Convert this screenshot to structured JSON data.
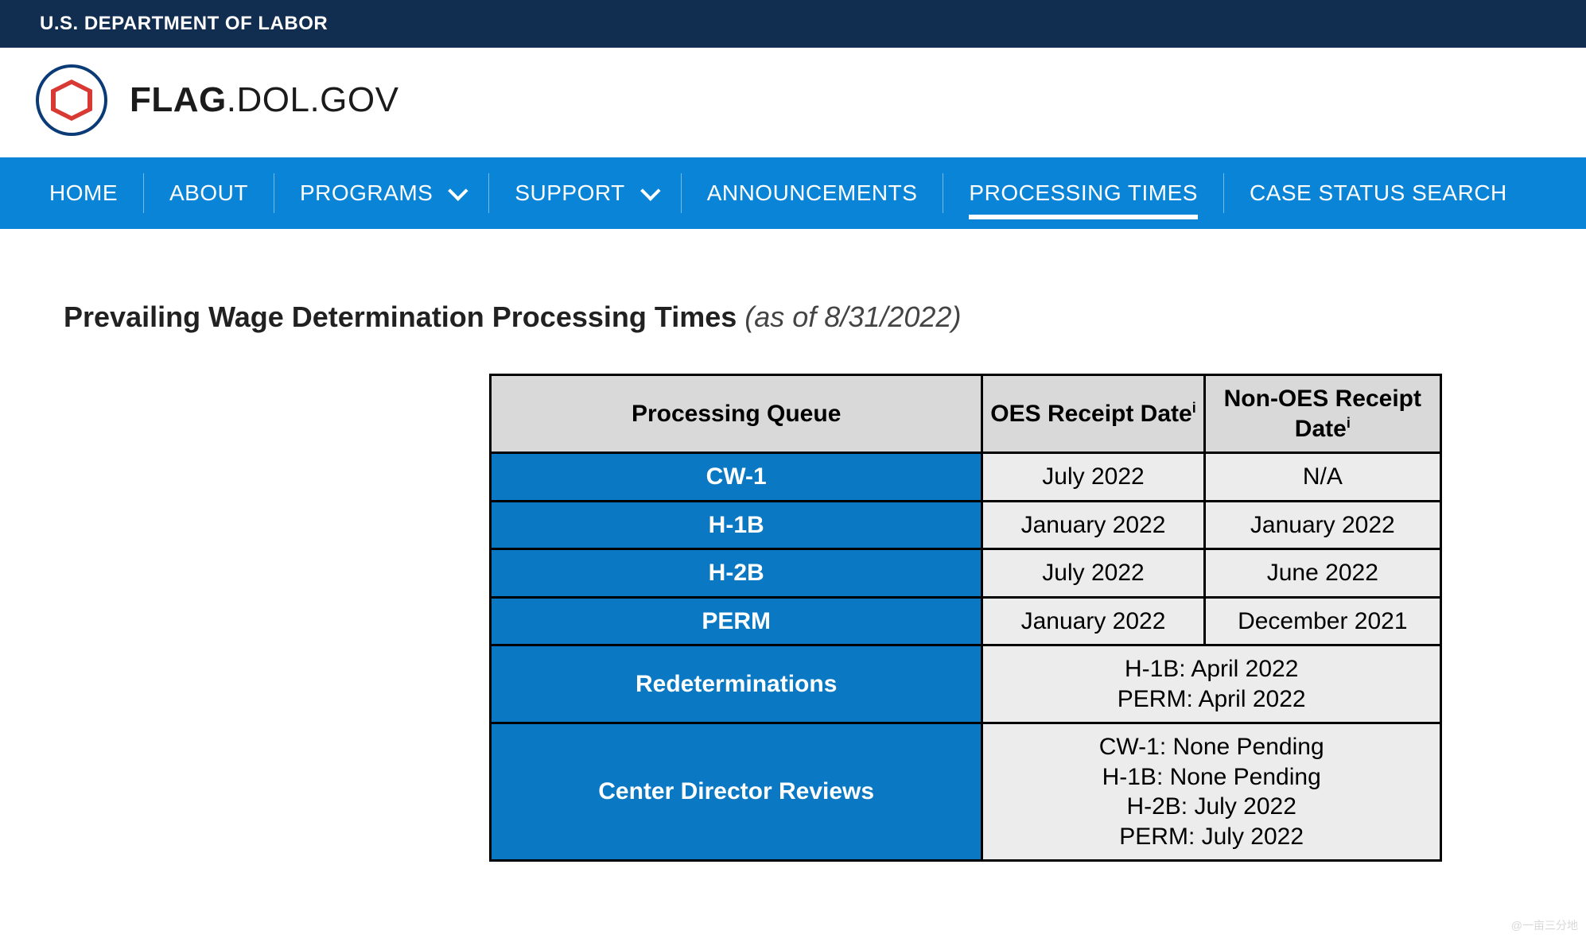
{
  "topbar": {
    "label": "U.S. DEPARTMENT OF LABOR"
  },
  "site": {
    "title_bold": "FLAG",
    "title_rest": ".DOL.GOV"
  },
  "nav": {
    "items": [
      {
        "label": "HOME",
        "has_dropdown": false,
        "active": false
      },
      {
        "label": "ABOUT",
        "has_dropdown": false,
        "active": false
      },
      {
        "label": "PROGRAMS",
        "has_dropdown": true,
        "active": false
      },
      {
        "label": "SUPPORT",
        "has_dropdown": true,
        "active": false
      },
      {
        "label": "ANNOUNCEMENTS",
        "has_dropdown": false,
        "active": false
      },
      {
        "label": "PROCESSING TIMES",
        "has_dropdown": false,
        "active": true
      },
      {
        "label": "CASE STATUS SEARCH",
        "has_dropdown": false,
        "active": false
      }
    ]
  },
  "page": {
    "heading_main": "Prevailing Wage Determination Processing Times ",
    "heading_asof": "(as of 8/31/2022)"
  },
  "table": {
    "headers": {
      "queue": "Processing Queue",
      "oes_prefix": "OES Receipt Date",
      "oes_footnote": "i",
      "non_prefix": "Non-OES Receipt Date",
      "non_footnote": "i"
    },
    "rows": [
      {
        "label": "CW-1",
        "oes": "July 2022",
        "non": "N/A"
      },
      {
        "label": "H-1B",
        "oes": "January 2022",
        "non": "January 2022"
      },
      {
        "label": "H-2B",
        "oes": "July 2022",
        "non": "June 2022"
      },
      {
        "label": "PERM",
        "oes": "January 2022",
        "non": "December 2021"
      }
    ],
    "merged_rows": [
      {
        "label": "Redeterminations",
        "lines": [
          "H-1B: April 2022",
          "PERM: April 2022"
        ]
      },
      {
        "label": "Center Director Reviews",
        "lines": [
          "CW-1: None Pending",
          "H-1B: None Pending",
          "H-2B: July 2022",
          "PERM: July 2022"
        ]
      }
    ]
  },
  "watermark": "@一亩三分地"
}
